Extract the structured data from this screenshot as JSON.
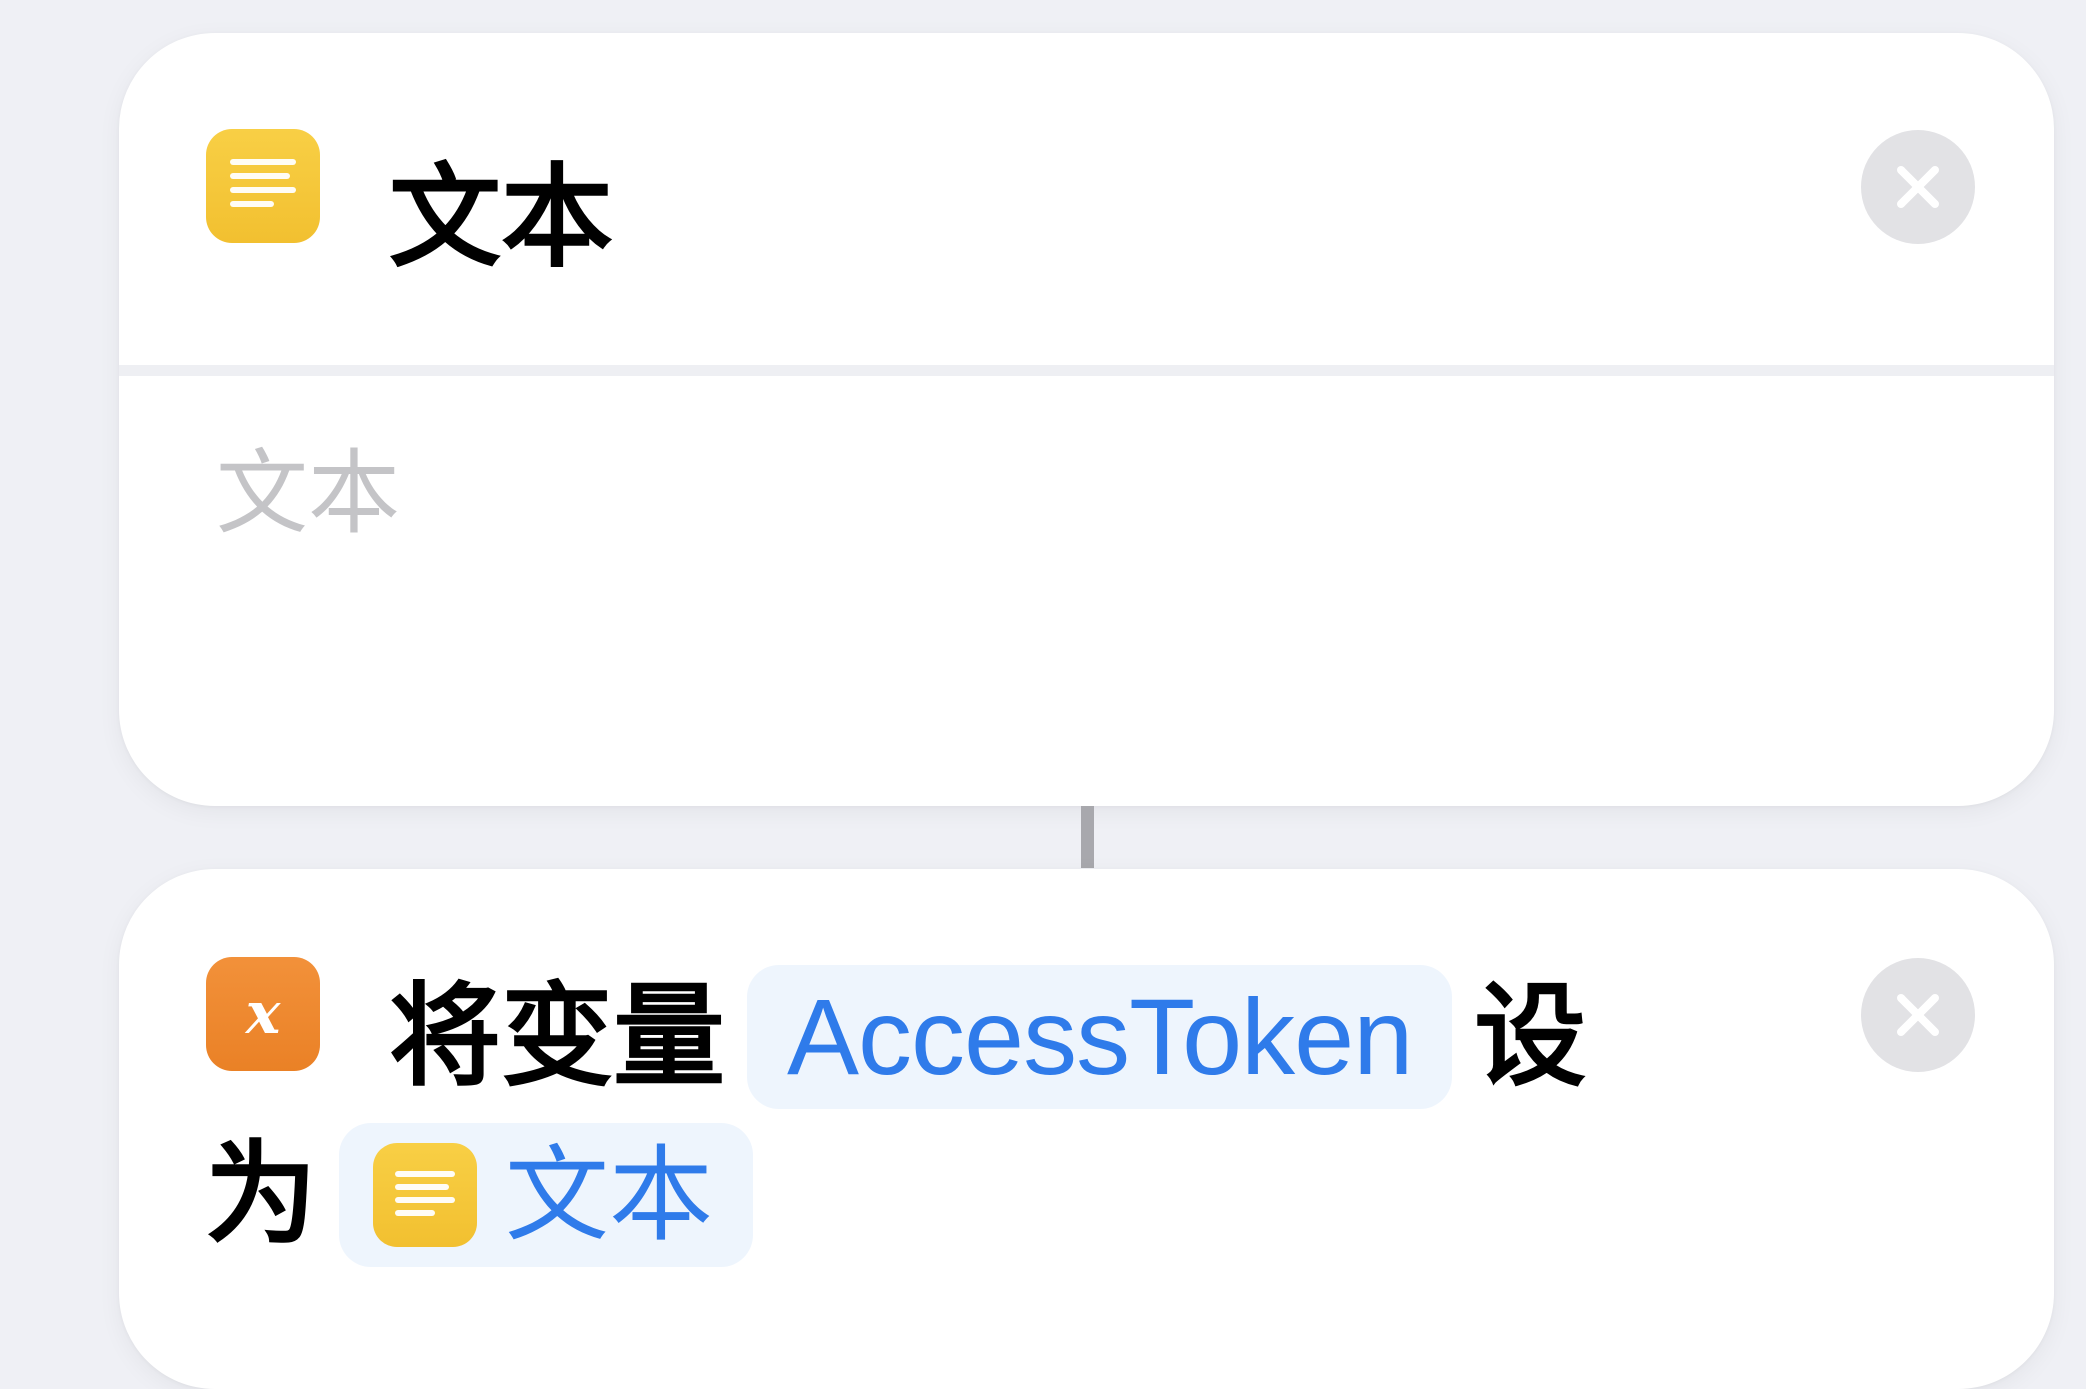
{
  "text_action": {
    "title": "文本",
    "icon": "text-lines-icon",
    "text_placeholder": "文本",
    "text_value": "",
    "close_icon": "close-icon"
  },
  "set_variable_action": {
    "icon": "variable-x-icon",
    "prefix": "将变量",
    "variable_name": "AccessToken",
    "middle": "设",
    "middle2": "为",
    "value_icon": "text-lines-icon",
    "value_label": "文本",
    "close_icon": "close-icon"
  },
  "colors": {
    "background": "#eff0f5",
    "card": "#ffffff",
    "text_icon": "#f4c536",
    "variable_icon": "#ee8a30",
    "token_text": "#2f7bea",
    "token_bg": "#eef5fd",
    "close_bg": "#e2e2e5"
  }
}
